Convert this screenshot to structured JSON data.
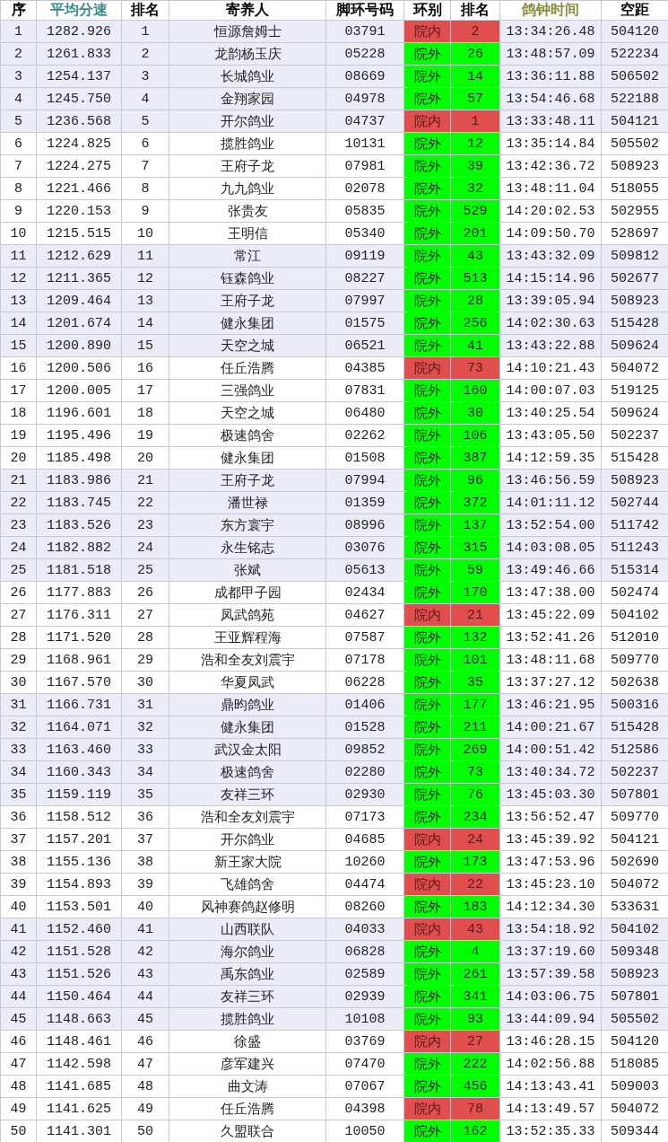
{
  "table": {
    "columns": [
      {
        "label": "序",
        "color": "#000000"
      },
      {
        "label": "平均分速",
        "color": "#3a8a8a"
      },
      {
        "label": "排名",
        "color": "#000000"
      },
      {
        "label": "寄养人",
        "color": "#000000"
      },
      {
        "label": "脚环号码",
        "color": "#000000"
      },
      {
        "label": "环别",
        "color": "#000000"
      },
      {
        "label": "排名",
        "color": "#000000"
      },
      {
        "label": "鸽钟时间",
        "color": "#8a8a3a"
      },
      {
        "label": "空距",
        "color": "#000000"
      }
    ],
    "rows": [
      {
        "kind": "inner",
        "cells": [
          "1",
          "1282.926",
          "1",
          "恒源詹姆士",
          "03791",
          "院内",
          "2",
          "13:34:26.48",
          "504120"
        ]
      },
      {
        "kind": "outer",
        "cells": [
          "2",
          "1261.833",
          "2",
          "龙韵杨玉庆",
          "05228",
          "院外",
          "26",
          "13:48:57.09",
          "522234"
        ]
      },
      {
        "kind": "outer",
        "cells": [
          "3",
          "1254.137",
          "3",
          "长城鸽业",
          "08669",
          "院外",
          "14",
          "13:36:11.88",
          "506502"
        ]
      },
      {
        "kind": "outer",
        "cells": [
          "4",
          "1245.750",
          "4",
          "金翔家园",
          "04978",
          "院外",
          "57",
          "13:54:46.68",
          "522188"
        ]
      },
      {
        "kind": "inner",
        "cells": [
          "5",
          "1236.568",
          "5",
          "开尔鸽业",
          "04737",
          "院内",
          "1",
          "13:33:48.11",
          "504121"
        ]
      },
      {
        "kind": "outer",
        "cells": [
          "6",
          "1224.825",
          "6",
          "揽胜鸽业",
          "10131",
          "院外",
          "12",
          "13:35:14.84",
          "505502"
        ]
      },
      {
        "kind": "outer",
        "cells": [
          "7",
          "1224.275",
          "7",
          "王府子龙",
          "07981",
          "院外",
          "39",
          "13:42:36.72",
          "508923"
        ]
      },
      {
        "kind": "outer",
        "cells": [
          "8",
          "1221.466",
          "8",
          "九九鸽业",
          "02078",
          "院外",
          "32",
          "13:48:11.04",
          "518055"
        ]
      },
      {
        "kind": "outer",
        "cells": [
          "9",
          "1220.153",
          "9",
          "张贵友",
          "05835",
          "院外",
          "529",
          "14:20:02.53",
          "502955"
        ]
      },
      {
        "kind": "outer",
        "cells": [
          "10",
          "1215.515",
          "10",
          "王明信",
          "05340",
          "院外",
          "201",
          "14:09:50.70",
          "528697"
        ]
      },
      {
        "kind": "outer",
        "cells": [
          "11",
          "1212.629",
          "11",
          "常江",
          "09119",
          "院外",
          "43",
          "13:43:32.09",
          "509812"
        ]
      },
      {
        "kind": "outer",
        "cells": [
          "12",
          "1211.365",
          "12",
          "钰森鸽业",
          "08227",
          "院外",
          "513",
          "14:15:14.96",
          "502677"
        ]
      },
      {
        "kind": "outer",
        "cells": [
          "13",
          "1209.464",
          "13",
          "王府子龙",
          "07997",
          "院外",
          "28",
          "13:39:05.94",
          "508923"
        ]
      },
      {
        "kind": "outer",
        "cells": [
          "14",
          "1201.674",
          "14",
          "健永集团",
          "01575",
          "院外",
          "256",
          "14:02:30.63",
          "515428"
        ]
      },
      {
        "kind": "outer",
        "cells": [
          "15",
          "1200.890",
          "15",
          "天空之城",
          "06521",
          "院外",
          "41",
          "13:43:22.88",
          "509624"
        ]
      },
      {
        "kind": "inner",
        "cells": [
          "16",
          "1200.506",
          "16",
          "任丘浩腾",
          "04385",
          "院内",
          "73",
          "14:10:21.43",
          "504072"
        ]
      },
      {
        "kind": "outer",
        "cells": [
          "17",
          "1200.005",
          "17",
          "三强鸽业",
          "07831",
          "院外",
          "160",
          "14:00:07.03",
          "519125"
        ]
      },
      {
        "kind": "outer",
        "cells": [
          "18",
          "1196.601",
          "18",
          "天空之城",
          "06480",
          "院外",
          "30",
          "13:40:25.54",
          "509624"
        ]
      },
      {
        "kind": "outer",
        "cells": [
          "19",
          "1195.496",
          "19",
          "极速鸽舍",
          "02262",
          "院外",
          "106",
          "13:43:05.50",
          "502237"
        ]
      },
      {
        "kind": "outer",
        "cells": [
          "20",
          "1185.498",
          "20",
          "健永集团",
          "01508",
          "院外",
          "387",
          "14:12:59.35",
          "515428"
        ]
      },
      {
        "kind": "outer",
        "cells": [
          "21",
          "1183.986",
          "21",
          "王府子龙",
          "07994",
          "院外",
          "96",
          "13:46:56.59",
          "508923"
        ]
      },
      {
        "kind": "outer",
        "cells": [
          "22",
          "1183.745",
          "22",
          "潘世禄",
          "01359",
          "院外",
          "372",
          "14:01:11.12",
          "502744"
        ]
      },
      {
        "kind": "outer",
        "cells": [
          "23",
          "1183.526",
          "23",
          "东方寰宇",
          "08996",
          "院外",
          "137",
          "13:52:54.00",
          "511742"
        ]
      },
      {
        "kind": "outer",
        "cells": [
          "24",
          "1182.882",
          "24",
          "永生铭志",
          "03076",
          "院外",
          "315",
          "14:03:08.05",
          "511243"
        ]
      },
      {
        "kind": "outer",
        "cells": [
          "25",
          "1181.518",
          "25",
          "张斌",
          "05613",
          "院外",
          "59",
          "13:49:46.66",
          "515314"
        ]
      },
      {
        "kind": "outer",
        "cells": [
          "26",
          "1177.883",
          "26",
          "成都甲子园",
          "02434",
          "院外",
          "170",
          "13:47:38.00",
          "502474"
        ]
      },
      {
        "kind": "inner",
        "cells": [
          "27",
          "1176.311",
          "27",
          "凤武鸽苑",
          "04627",
          "院内",
          "21",
          "13:45:22.09",
          "504102"
        ]
      },
      {
        "kind": "outer",
        "cells": [
          "28",
          "1171.520",
          "28",
          "王亚辉程海",
          "07587",
          "院外",
          "132",
          "13:52:41.26",
          "512010"
        ]
      },
      {
        "kind": "outer",
        "cells": [
          "29",
          "1168.961",
          "29",
          "浩和全友刘震宇",
          "07178",
          "院外",
          "101",
          "13:48:11.68",
          "509770"
        ]
      },
      {
        "kind": "outer",
        "cells": [
          "30",
          "1167.570",
          "30",
          "华夏凤武",
          "06228",
          "院外",
          "35",
          "13:37:27.12",
          "502638"
        ]
      },
      {
        "kind": "outer",
        "cells": [
          "31",
          "1166.731",
          "31",
          "鼎昀鸽业",
          "01406",
          "院外",
          "177",
          "13:46:21.95",
          "500316"
        ]
      },
      {
        "kind": "outer",
        "cells": [
          "32",
          "1164.071",
          "32",
          "健永集团",
          "01528",
          "院外",
          "211",
          "14:00:21.67",
          "515428"
        ]
      },
      {
        "kind": "outer",
        "cells": [
          "33",
          "1163.460",
          "33",
          "武汉金太阳",
          "09852",
          "院外",
          "269",
          "14:00:51.42",
          "512586"
        ]
      },
      {
        "kind": "outer",
        "cells": [
          "34",
          "1160.343",
          "34",
          "极速鸽舍",
          "02280",
          "院外",
          "73",
          "13:40:34.72",
          "502237"
        ]
      },
      {
        "kind": "outer",
        "cells": [
          "35",
          "1159.119",
          "35",
          "友祥三环",
          "02930",
          "院外",
          "76",
          "13:45:03.30",
          "507801"
        ]
      },
      {
        "kind": "outer",
        "cells": [
          "36",
          "1158.512",
          "36",
          "浩和全友刘震宇",
          "07173",
          "院外",
          "234",
          "13:56:52.47",
          "509770"
        ]
      },
      {
        "kind": "inner",
        "cells": [
          "37",
          "1157.201",
          "37",
          "开尔鸽业",
          "04685",
          "院内",
          "24",
          "13:45:39.92",
          "504121"
        ]
      },
      {
        "kind": "outer",
        "cells": [
          "38",
          "1155.136",
          "38",
          "新王家大院",
          "10260",
          "院外",
          "173",
          "13:47:53.96",
          "502690"
        ]
      },
      {
        "kind": "inner",
        "cells": [
          "39",
          "1154.893",
          "39",
          "飞雄鸽舍",
          "04474",
          "院内",
          "22",
          "13:45:23.10",
          "504072"
        ]
      },
      {
        "kind": "outer",
        "cells": [
          "40",
          "1153.501",
          "40",
          "风神赛鸽赵修明",
          "08260",
          "院外",
          "183",
          "14:12:34.30",
          "533631"
        ]
      },
      {
        "kind": "inner",
        "cells": [
          "41",
          "1152.460",
          "41",
          "山西联队",
          "04033",
          "院内",
          "43",
          "13:54:18.92",
          "504102"
        ]
      },
      {
        "kind": "outer",
        "cells": [
          "42",
          "1151.528",
          "42",
          "海尔鸽业",
          "06828",
          "院外",
          "4",
          "13:37:19.60",
          "509348"
        ]
      },
      {
        "kind": "outer",
        "cells": [
          "43",
          "1151.526",
          "43",
          "禹东鸽业",
          "02589",
          "院外",
          "261",
          "13:57:39.58",
          "508923"
        ]
      },
      {
        "kind": "outer",
        "cells": [
          "44",
          "1150.464",
          "44",
          "友祥三环",
          "02939",
          "院外",
          "341",
          "14:03:06.75",
          "507801"
        ]
      },
      {
        "kind": "outer",
        "cells": [
          "45",
          "1148.663",
          "45",
          "揽胜鸽业",
          "10108",
          "院外",
          "93",
          "13:44:09.94",
          "505502"
        ]
      },
      {
        "kind": "inner",
        "cells": [
          "46",
          "1148.461",
          "46",
          "徐盛",
          "03769",
          "院内",
          "27",
          "13:46:28.15",
          "504120"
        ]
      },
      {
        "kind": "outer",
        "cells": [
          "47",
          "1142.598",
          "47",
          "彦军建兴",
          "07470",
          "院外",
          "222",
          "14:02:56.88",
          "518085"
        ]
      },
      {
        "kind": "outer",
        "cells": [
          "48",
          "1141.685",
          "48",
          "曲文涛",
          "07067",
          "院外",
          "456",
          "14:13:43.41",
          "509003"
        ]
      },
      {
        "kind": "inner",
        "cells": [
          "49",
          "1141.625",
          "49",
          "任丘浩腾",
          "04398",
          "院内",
          "78",
          "14:13:49.57",
          "504072"
        ]
      },
      {
        "kind": "outer",
        "cells": [
          "50",
          "1141.301",
          "50",
          "久盟联合",
          "10050",
          "院外",
          "162",
          "13:52:35.33",
          "509344"
        ]
      }
    ]
  }
}
